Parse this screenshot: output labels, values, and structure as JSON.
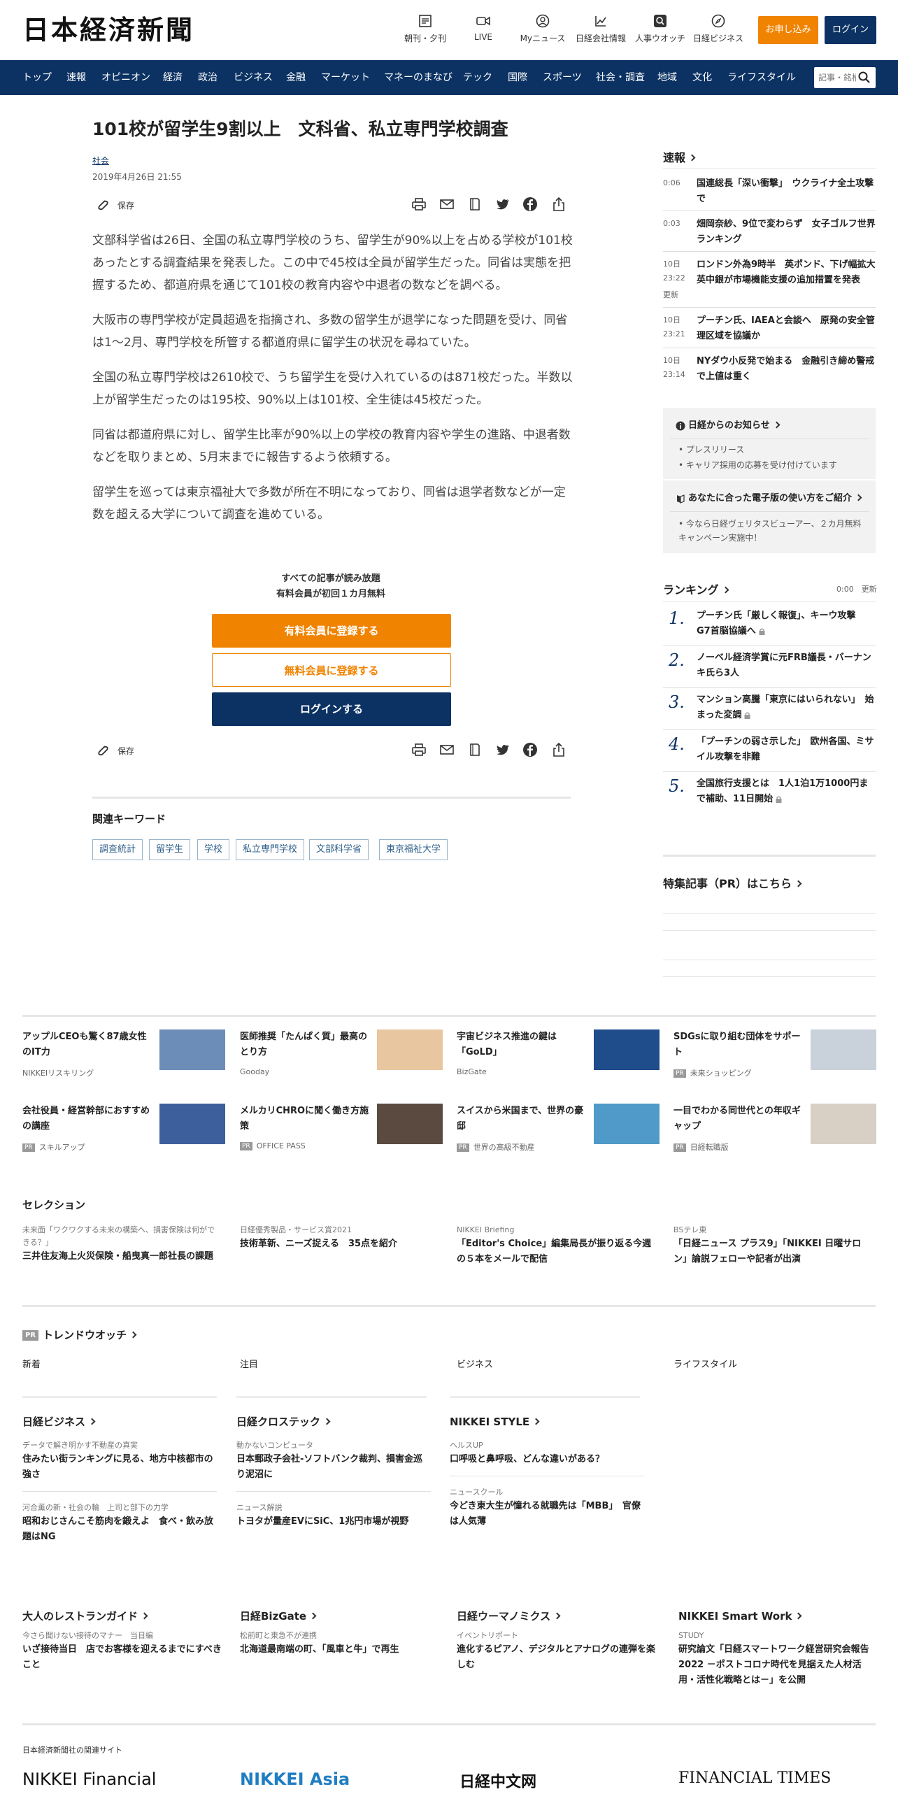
{
  "header": {
    "logo": "日本経済新聞",
    "icons": [
      {
        "label": "朝刊・夕刊",
        "icon": "newspaper-icon"
      },
      {
        "label": "LIVE",
        "icon": "video-icon"
      },
      {
        "label": "Myニュース",
        "icon": "user-circle-icon"
      },
      {
        "label": "日経会社情報",
        "icon": "chart-icon"
      },
      {
        "label": "人事ウオッチ",
        "icon": "search-icon"
      },
      {
        "label": "日経ビジネス",
        "icon": "compass-icon"
      }
    ],
    "apply_label": "お申し込み",
    "login_label": "ログイン"
  },
  "nav": {
    "items": [
      "トップ",
      "速報",
      "オピニオン",
      "経済",
      "政治",
      "ビジネス",
      "金融",
      "マーケット",
      "マネーのまなび",
      "テック",
      "国際",
      "スポーツ",
      "社会・調査",
      "地域",
      "文化",
      "ライフスタイル"
    ],
    "search_placeholder": "記事・銘柄"
  },
  "article": {
    "title": "101校が留学生9割以上　文科省、私立専門学校調査",
    "category": "社会",
    "date": "2019年4月26日 21:55",
    "save_label": "保存",
    "paragraphs": [
      "文部科学省は26日、全国の私立専門学校のうち、留学生が90%以上を占める学校が101校あったとする調査結果を発表した。この中で45校は全員が留学生だった。同省は実態を把握するため、都道府県を通じて101校の教育内容や中退者の数などを調べる。",
      "大阪市の専門学校が定員超過を指摘され、多数の留学生が退学になった問題を受け、同省は1～2月、専門学校を所管する都道府県に留学生の状況を尋ねていた。",
      "全国の私立専門学校は2610校で、うち留学生を受け入れているのは871校だった。半数以上が留学生だったのは195校、90%以上は101校、全生徒は45校だった。",
      "同省は都道府県に対し、留学生比率が90%以上の学校の教育内容や学生の進路、中退者数などを取りまとめ、5月末までに報告するよう依頼する。",
      "留学生を巡っては東京福祉大で多数が所在不明になっており、同省は退学者数などが一定数を超える大学について調査を進めている。"
    ],
    "promo_line1": "すべての記事が読み放題",
    "promo_line2": "有料会員が初回１カ月無料",
    "btn_paid": "有料会員に登録する",
    "btn_free": "無料会員に登録する",
    "btn_login": "ログインする",
    "keywords_title": "関連キーワード",
    "keywords": [
      "調査統計",
      "留学生",
      "学校",
      "私立専門学校",
      "文部科学省",
      "東京福祉大学"
    ]
  },
  "sidebar": {
    "breaking_title": "速報",
    "breaking": [
      {
        "time": "0:06",
        "title": "国連総長「深い衝撃」　ウクライナ全土攻撃で",
        "updated": ""
      },
      {
        "time": "0:03",
        "title": "畑岡奈紗、9位で変わらず　女子ゴルフ世界ランキング",
        "updated": ""
      },
      {
        "time": "10日 23:22",
        "title": "ロンドン外為9時半　英ポンド、下げ幅拡大　英中銀が市場機能支援の追加措置を発表",
        "updated": "更新"
      },
      {
        "time": "10日 23:21",
        "title": "プーチン氏、IAEAと会談へ　原発の安全管理区域を協議か",
        "updated": ""
      },
      {
        "time": "10日 23:14",
        "title": "NYダウ小反発で始まる　金融引き締め警戒で上値は重く",
        "updated": ""
      }
    ],
    "notice_title": "日経からのお知らせ",
    "notice_items": [
      "プレスリリース",
      "キャリア採用の応募を受け付けています"
    ],
    "ebook_title": "あなたに合った電子版の使い方をご紹介",
    "ebook_items": [
      "今なら日経ヴェリタスビューアー、２カ月無料キャンペーン実施中！"
    ],
    "ranking_title": "ランキング",
    "ranking_time": "0:00",
    "ranking_update": "更新",
    "ranking": [
      {
        "num": "1.",
        "title": "プーチン氏「厳しく報復」、キーウ攻撃　G7首脳協議へ",
        "lock": true
      },
      {
        "num": "2.",
        "title": "ノーベル経済学賞に元FRB議長・バーナンキ氏ら3人",
        "lock": false
      },
      {
        "num": "3.",
        "title": "マンション高騰「東京にはいられない」　始まった変調",
        "lock": true
      },
      {
        "num": "4.",
        "title": "「プーチンの弱さ示した」　欧州各国、ミサイル攻撃を非難",
        "lock": false
      },
      {
        "num": "5.",
        "title": "全国旅行支援とは　1人1泊1万1000円まで補助、11日開始",
        "lock": true
      }
    ],
    "feature_title": "特集記事（PR）はこちら"
  },
  "ads": [
    {
      "title": "アップルCEOも驚く87歳女性のIT力",
      "source": "NIKKEIリスキリング",
      "pr": false,
      "img": "#6c8db8"
    },
    {
      "title": "医師推奨「たんぱく質」最高のとり方",
      "source": "Gooday",
      "pr": false,
      "img": "#e8c6a0"
    },
    {
      "title": "宇宙ビジネス推進の鍵は「GoLD」",
      "source": "BizGate",
      "pr": false,
      "img": "#1f4c8a"
    },
    {
      "title": "SDGsに取り組む団体をサポート",
      "source": "未来ショッピング",
      "pr": true,
      "img": "#c9d2da"
    },
    {
      "title": "会社役員・経営幹部におすすめの講座",
      "source": "スキルアップ",
      "pr": true,
      "img": "#3d5f9c"
    },
    {
      "title": "メルカリCHROに聞く働き方施策",
      "source": "OFFICE PASS",
      "pr": true,
      "img": "#5a4a3f"
    },
    {
      "title": "スイスから米国まで、世界の豪邸",
      "source": "世界の高級不動産",
      "pr": true,
      "img": "#4f9ac9"
    },
    {
      "title": "一目でわかる同世代との年収ギャップ",
      "source": "日経転職版",
      "pr": true,
      "img": "#d8d0c4"
    }
  ],
  "selection": {
    "title": "セレクション",
    "items": [
      {
        "cat": "未来面「ワクワクする未来の構築へ、損害保険は何ができる？」",
        "title": "三井住友海上火災保険・船曳真一郎社長の課題"
      },
      {
        "cat": "日経優秀製品・サービス賞2021",
        "title": "技術革新、ニーズ捉える　35点を紹介"
      },
      {
        "cat": "NIKKEI Briefing",
        "title": "「Editor's Choice」編集局長が振り返る今週の５本をメールで配信"
      },
      {
        "cat": "BSテレ東",
        "title": "「日経ニュース プラス9」「NIKKEI 日曜サロン」論説フェローや記者が出演"
      }
    ]
  },
  "trend": {
    "title": "トレンドウオッチ",
    "cols": [
      "新着",
      "注目",
      "ビジネス",
      "ライフスタイル"
    ]
  },
  "blocks_row1": [
    {
      "head": "日経ビジネス",
      "items": [
        {
          "cat": "データで解き明かす不動産の真実",
          "title": "住みたい街ランキングに見る、地方中核都市の強さ"
        },
        {
          "cat": "河合薫の新・社会の輪　上司と部下の力学",
          "title": "昭和おじさんこそ筋肉を鍛えよ　食べ・飲み放題はNG"
        }
      ]
    },
    {
      "head": "日経クロステック",
      "items": [
        {
          "cat": "動かないコンピュータ",
          "title": "日本郵政子会社-ソフトバンク裁判、損害金巡り泥沼に"
        },
        {
          "cat": "ニュース解説",
          "title": "トヨタが量産EVにSiC、1兆円市場が視野"
        }
      ]
    },
    {
      "head": "NIKKEI STYLE",
      "items": [
        {
          "cat": "ヘルスUP",
          "title": "口呼吸と鼻呼吸、どんな違いがある？"
        },
        {
          "cat": "ニュースクール",
          "title": "今どき東大生が憧れる就職先は「MBB」　官僚は人気薄"
        }
      ]
    }
  ],
  "blocks_row2": [
    {
      "head": "大人のレストランガイド",
      "cat": "今さら聞けない接待のマナー　当日編",
      "title": "いざ接待当日　店でお客様を迎えるまでにすべきこと"
    },
    {
      "head": "日経BizGate",
      "cat": "松前町と東急不が連携",
      "title": "北海道最南端の町、「風車と牛」で再生"
    },
    {
      "head": "日経ウーマノミクス",
      "cat": "イベントリポート",
      "title": "進化するピアノ、デジタルとアナログの連弾を楽しむ"
    },
    {
      "head": "NIKKEI Smart Work",
      "cat": "STUDY",
      "title": "研究論文「日経スマートワーク経営研究会報告2022 －ポストコロナ時代を見据えた人材活用・活性化戦略とは－」を公開"
    }
  ],
  "footer": {
    "related_title": "日本経済新聞社の関連サイト",
    "logos": [
      "NIKKEI Financial",
      "NIKKEI Asia",
      "日経中文网",
      "FINANCIAL TIMES"
    ]
  }
}
